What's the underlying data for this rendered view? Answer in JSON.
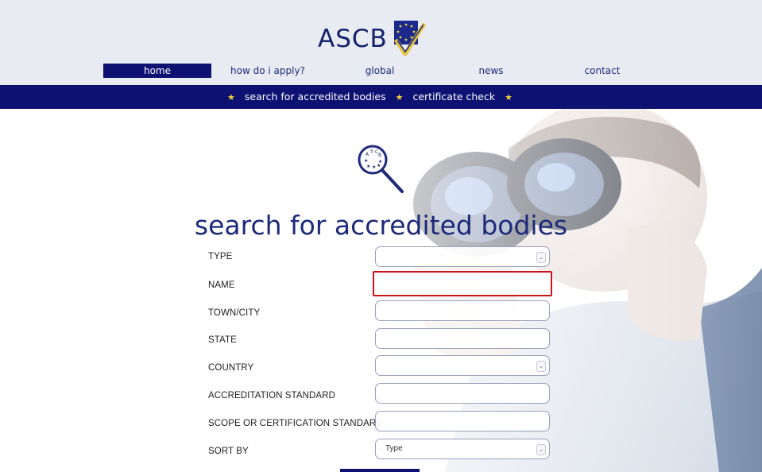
{
  "logo": {
    "text": "ASCB"
  },
  "nav": {
    "items": [
      {
        "label": "home",
        "active": true
      },
      {
        "label": "how do i apply?"
      },
      {
        "label": "global"
      },
      {
        "label": "news"
      },
      {
        "label": "contact"
      }
    ]
  },
  "subnav": {
    "items": [
      "search for accredited bodies",
      "certificate check"
    ],
    "star": "★"
  },
  "page": {
    "title": "search for accredited bodies"
  },
  "form": {
    "fields": [
      {
        "label": "TYPE",
        "kind": "select",
        "value": ""
      },
      {
        "label": "NAME",
        "kind": "text",
        "value": "",
        "focused": true
      },
      {
        "label": "TOWN/CITY",
        "kind": "text",
        "value": ""
      },
      {
        "label": "STATE",
        "kind": "text",
        "value": ""
      },
      {
        "label": "COUNTRY",
        "kind": "select",
        "value": ""
      },
      {
        "label": "ACCREDITATION STANDARD",
        "kind": "text",
        "value": ""
      },
      {
        "label": "SCOPE OR CERTIFICATION STANDARD",
        "kind": "text",
        "value": ""
      },
      {
        "label": "SORT BY",
        "kind": "select",
        "value": "Type"
      }
    ]
  },
  "colors": {
    "navy": "#0d1172",
    "title": "#1d2a7a",
    "focus": "#c8141b",
    "header_bg": "#e9ebf3",
    "star": "#f2d13a"
  }
}
